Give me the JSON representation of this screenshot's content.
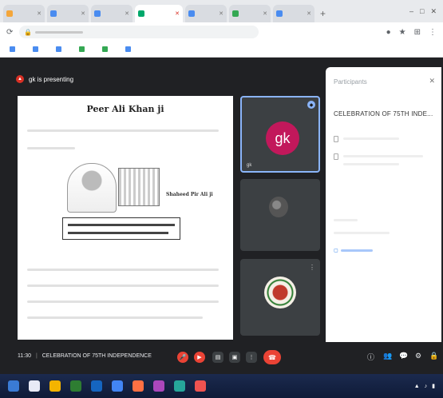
{
  "browser": {
    "tabs": [
      {
        "label": "",
        "color": "#f4a63a"
      },
      {
        "label": "",
        "color": "#4a8cf0"
      },
      {
        "label": "",
        "color": "#4a8cf0"
      },
      {
        "label": "",
        "color": "#00a86b",
        "active": true
      },
      {
        "label": "",
        "color": "#4a8cf0"
      },
      {
        "label": "",
        "color": "#34a853"
      },
      {
        "label": "",
        "color": "#4a8cf0"
      }
    ]
  },
  "meet": {
    "presenting_label": "gk is presenting",
    "slide": {
      "title": "Peer Ali Khan ji",
      "portrait_caption": "Shaheed Pir Ali ji"
    },
    "tiles": [
      {
        "initials": "gk",
        "name": "gk",
        "active": true
      },
      {
        "initials": "",
        "name": "",
        "active": false
      },
      {
        "initials": "",
        "name": "",
        "active": false
      }
    ],
    "panel": {
      "header": "Participants",
      "meeting_title": "CELEBRATION OF 75TH INDE..."
    },
    "toolbar": {
      "time": "11:30",
      "separator": "|",
      "meeting_name": "CELEBRATION OF 75TH INDEPENDENCE"
    }
  },
  "colors": {
    "meet_bg": "#202124",
    "end_call": "#ea4335",
    "avatar": "#c2185b",
    "accent": "#8ab4f8"
  }
}
